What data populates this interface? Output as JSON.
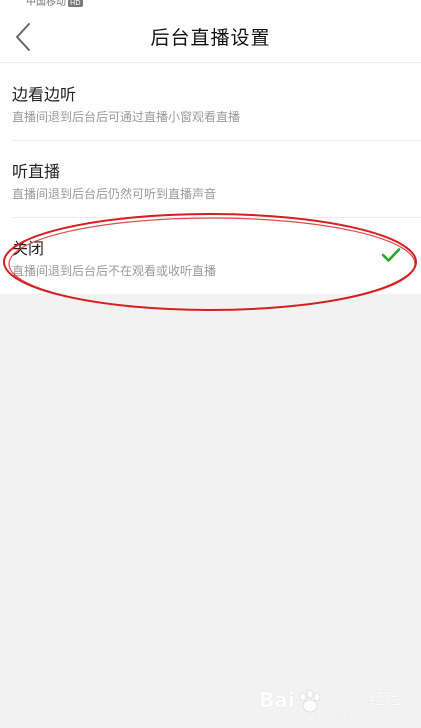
{
  "status_bar": {
    "carrier": "中国移动",
    "network": "HD"
  },
  "header": {
    "title": "后台直播设置",
    "back_icon": "chevron-left-icon"
  },
  "options": [
    {
      "title": "边看边听",
      "description": "直播间退到后台后可通过直播小窗观看直播",
      "selected": false
    },
    {
      "title": "听直播",
      "description": "直播间退到后台后仍然可听到直播声音",
      "selected": false
    },
    {
      "title": "关闭",
      "description": "直播间退到后台后不在观看或收听直播",
      "selected": true
    }
  ],
  "colors": {
    "check": "#2aa52a",
    "annotation": "#d42020",
    "background": "#f2f2f2"
  },
  "watermark": {
    "brand": "Bai",
    "brand_suffix": "经验",
    "url": "jingyan.baidu.com"
  }
}
